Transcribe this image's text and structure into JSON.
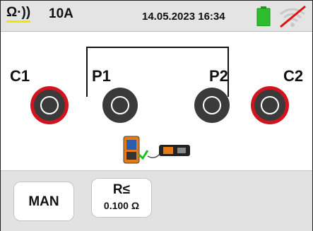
{
  "status": {
    "mode_symbol": "Ω·))",
    "range": "10A",
    "datetime": "14.05.2023  16:34",
    "battery_icon": "battery-icon",
    "battery_color": "#2ebd2e",
    "wifi_icon": "wifi-disabled-icon",
    "wifi_slash_color": "#e01010"
  },
  "diagram": {
    "labels": {
      "c1": "C1",
      "p1": "P1",
      "p2": "P2",
      "c2": "C2"
    },
    "current_terminal_color": "#d1141e",
    "potential_terminal_color": "#3a3a3a",
    "device_icon": "instrument-connection-icon"
  },
  "buttons": {
    "mode": "MAN",
    "limit_symbol": "R≤",
    "limit_value": "0.100 Ω"
  }
}
